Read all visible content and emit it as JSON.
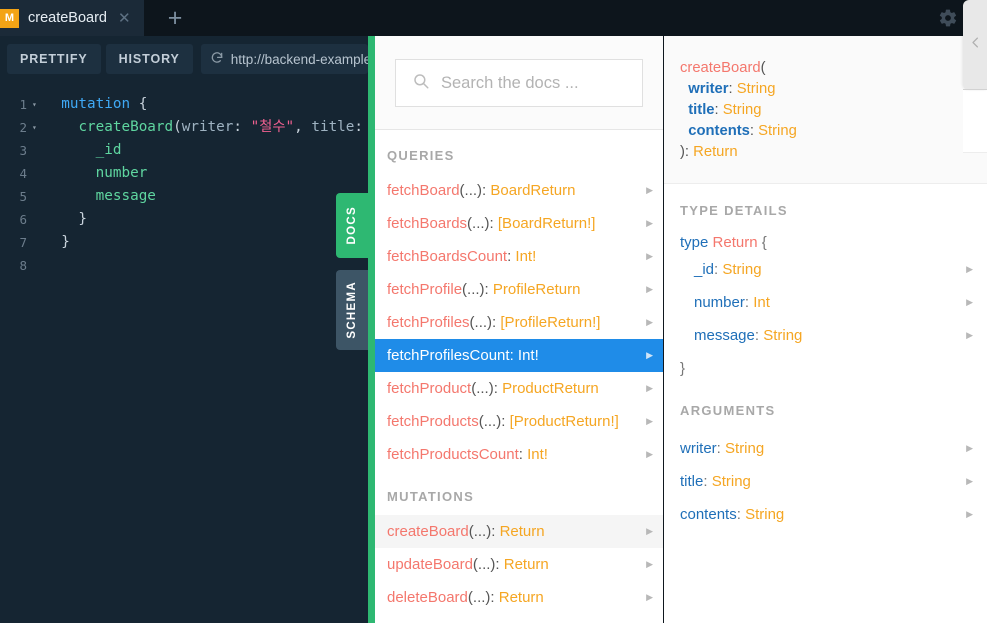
{
  "header": {
    "tab": {
      "badge": "M",
      "title": "createBoard",
      "close_icon": "close-icon"
    },
    "add_tab_label": "+",
    "settings_icon": "gear-icon"
  },
  "editor": {
    "prettify_label": "PRETTIFY",
    "history_label": "HISTORY",
    "url_value": "http://backend-example.co",
    "refresh_icon": "refresh-icon",
    "lines": [
      {
        "n": "1",
        "fold": "▾",
        "tokens": [
          {
            "t": "  ",
            "c": "k-plain"
          },
          {
            "t": "mutation",
            "c": "k-mut"
          },
          {
            "t": " {",
            "c": "k-punc"
          }
        ]
      },
      {
        "n": "2",
        "fold": "▾",
        "tokens": [
          {
            "t": "    ",
            "c": "k-plain"
          },
          {
            "t": "createBoard",
            "c": "k-field"
          },
          {
            "t": "(",
            "c": "k-punc"
          },
          {
            "t": "writer",
            "c": "k-arg"
          },
          {
            "t": ": ",
            "c": "k-punc"
          },
          {
            "t": "\"철수\"",
            "c": "k-str"
          },
          {
            "t": ", ",
            "c": "k-punc"
          },
          {
            "t": "title",
            "c": "k-arg"
          },
          {
            "t": ":",
            "c": "k-punc"
          }
        ]
      },
      {
        "n": "3",
        "fold": "",
        "tokens": [
          {
            "t": "      ",
            "c": "k-plain"
          },
          {
            "t": "_id",
            "c": "k-field"
          }
        ]
      },
      {
        "n": "4",
        "fold": "",
        "tokens": [
          {
            "t": "      ",
            "c": "k-plain"
          },
          {
            "t": "number",
            "c": "k-field"
          }
        ]
      },
      {
        "n": "5",
        "fold": "",
        "tokens": [
          {
            "t": "      ",
            "c": "k-plain"
          },
          {
            "t": "message",
            "c": "k-field"
          }
        ]
      },
      {
        "n": "6",
        "fold": "",
        "tokens": [
          {
            "t": "    }",
            "c": "k-punc"
          }
        ]
      },
      {
        "n": "7",
        "fold": "",
        "tokens": [
          {
            "t": "  }",
            "c": "k-punc"
          }
        ]
      },
      {
        "n": "8",
        "fold": "",
        "tokens": []
      }
    ],
    "side_tabs": [
      {
        "label": "DOCS",
        "active": true
      },
      {
        "label": "SCHEMA",
        "active": false
      }
    ]
  },
  "docs": {
    "search_placeholder": "Search the docs ...",
    "search_value": "",
    "search_icon": "search-icon",
    "sections": [
      {
        "title": "QUERIES",
        "items": [
          {
            "name": "fetchBoard",
            "args": "(...)",
            "colon": ": ",
            "type": "BoardReturn",
            "state": ""
          },
          {
            "name": "fetchBoards",
            "args": "(...)",
            "colon": ": ",
            "type": "[BoardReturn!]",
            "state": ""
          },
          {
            "name": "fetchBoardsCount",
            "args": "",
            "colon": ": ",
            "type": "Int!",
            "state": ""
          },
          {
            "name": "fetchProfile",
            "args": "(...)",
            "colon": ": ",
            "type": "ProfileReturn",
            "state": ""
          },
          {
            "name": "fetchProfiles",
            "args": "(...)",
            "colon": ": ",
            "type": "[ProfileReturn!]",
            "state": ""
          },
          {
            "name": "fetchProfilesCount",
            "args": "",
            "colon": ": ",
            "type": "Int!",
            "state": "selected"
          },
          {
            "name": "fetchProduct",
            "args": "(...)",
            "colon": ": ",
            "type": "ProductReturn",
            "state": ""
          },
          {
            "name": "fetchProducts",
            "args": "(...)",
            "colon": ": ",
            "type": "[ProductReturn!]",
            "state": ""
          },
          {
            "name": "fetchProductsCount",
            "args": "",
            "colon": ": ",
            "type": "Int!",
            "state": ""
          }
        ]
      },
      {
        "title": "MUTATIONS",
        "items": [
          {
            "name": "createBoard",
            "args": "(...)",
            "colon": ": ",
            "type": "Return",
            "state": "hovered"
          },
          {
            "name": "updateBoard",
            "args": "(...)",
            "colon": ": ",
            "type": "Return",
            "state": ""
          },
          {
            "name": "deleteBoard",
            "args": "(...)",
            "colon": ": ",
            "type": "Return",
            "state": ""
          }
        ]
      }
    ]
  },
  "detail": {
    "signature": {
      "name": "createBoard",
      "open_paren": "(",
      "args": [
        {
          "name": "writer",
          "colon": ": ",
          "type": "String"
        },
        {
          "name": "title",
          "colon": ": ",
          "type": "String"
        },
        {
          "name": "contents",
          "colon": ": ",
          "type": "String"
        }
      ],
      "close": "): ",
      "return_type": "Return"
    },
    "type_details": {
      "heading": "TYPE DETAILS",
      "kw": "type ",
      "name": "Return",
      "open_brace": " {",
      "close_brace": "}",
      "fields": [
        {
          "name": "_id",
          "colon": ": ",
          "type": "String"
        },
        {
          "name": "number",
          "colon": ": ",
          "type": "Int"
        },
        {
          "name": "message",
          "colon": ": ",
          "type": "String"
        }
      ]
    },
    "arguments": {
      "heading": "ARGUMENTS",
      "items": [
        {
          "name": "writer",
          "colon": ": ",
          "type": "String"
        },
        {
          "name": "title",
          "colon": ": ",
          "type": "String"
        },
        {
          "name": "contents",
          "colon": ": ",
          "type": "String"
        }
      ]
    },
    "collapse_icon": "chevron-left-icon"
  },
  "colors": {
    "accent_green": "#2eb872",
    "selected_blue": "#1f8ce8",
    "field_red": "#f4776d",
    "type_orange": "#f5a623",
    "arg_blue": "#1f6fb8",
    "badge_orange": "#f3a416",
    "editor_bg": "#152532"
  }
}
